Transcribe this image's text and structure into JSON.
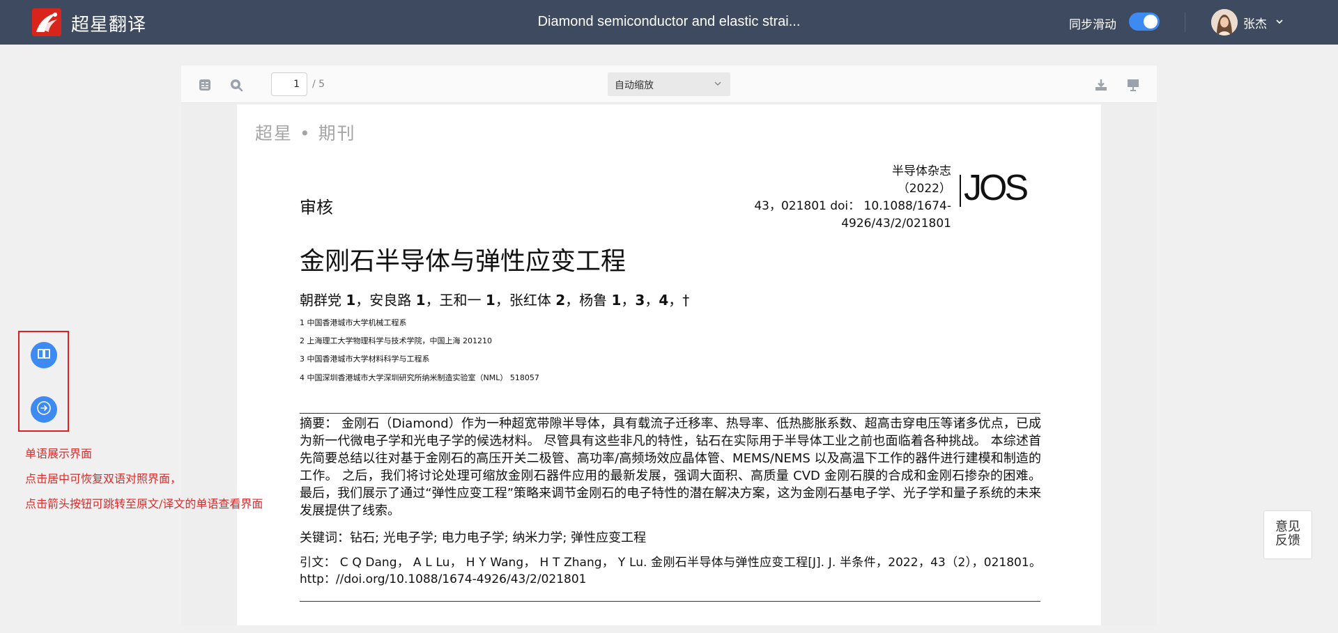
{
  "header": {
    "app_name": "超星翻译",
    "doc_title": "Diamond semiconductor and elastic strai...",
    "sync_label": "同步滑动",
    "sync_enabled": true,
    "user_name": "张杰",
    "colors": {
      "bar": "#3e4a5f",
      "toggle": "#3d8bf2",
      "logo": "#d9241b"
    }
  },
  "toolbar": {
    "page_current": "1",
    "page_total": "/ 5",
    "zoom_selected": "自动缩放",
    "icons": [
      "sidebar-toggle-icon",
      "search-icon",
      "download-icon",
      "presentation-icon"
    ]
  },
  "paper": {
    "journal_mark": "超星 • 期刊",
    "review_label": "审核",
    "journal_info": [
      "半导体杂志",
      "（2022）",
      "43，021801 doi： 10.1088/1674-",
      "4926/43/2/021801"
    ],
    "journal_logo": "JOS",
    "title": "金刚石半导体与弹性应变工程",
    "authors": [
      "朝群党 ",
      "1",
      "，安良路 ",
      "1",
      "，王和一 ",
      "1",
      "，张红体 ",
      "2",
      "，杨鲁 ",
      "1",
      "，",
      "3",
      "，",
      "4",
      "，†"
    ],
    "affiliations": [
      "1 中国香港城市大学机械工程系",
      "2 上海理工大学物理科学与技术学院，中国上海 201210",
      "3 中国香港城市大学材料科学与工程系",
      "4 中国深圳香港城市大学深圳研究所纳米制造实验室（NML） 518057"
    ],
    "abstract": "摘要： 金刚石（Diamond）作为一种超宽带隙半导体，具有载流子迁移率、热导率、低热膨胀系数、超高击穿电压等诸多优点，已成为新一代微电子学和光电子学的候选材料。 尽管具有这些非凡的特性，钻石在实际用于半导体工业之前也面临着各种挑战。 本综述首先简要总结以往对基于金刚石的高压开关二极管、高功率/高频场效应晶体管、MEMS/NEMS 以及高温下工作的器件进行建模和制造的工作。 之后，我们将讨论处理可缩放金刚石器件应用的最新发展，强调大面积、高质量 CVD 金刚石膜的合成和金刚石掺杂的困难。 最后，我们展示了通过“弹性应变工程”策略来调节金刚石的电子特性的潜在解决方案，这为金刚石基电子学、光子学和量子系统的未来发展提供了线索。",
    "keywords": "关键词：钻石; 光电子学; 电力电子学; 纳米力学; 弹性应变工程",
    "citation": "引文： C Q Dang， A L Lu， H Y Wang， H T Zhang， Y Lu. 金刚石半导体与弹性应变工程[J]. J. 半条件，2022，43（2），021801。 http：//doi.org/10.1088/1674-4926/43/2/021801"
  },
  "side_controls": {
    "buttons": [
      "bilingual-view-icon",
      "arrow-right-icon"
    ],
    "notes": [
      "单语展示界面",
      "点击居中可恢复双语对照界面，",
      "点击箭头按钮可跳转至原文/译文的单语查看界面"
    ]
  },
  "feedback": {
    "line1": "意见",
    "line2": "反馈"
  }
}
